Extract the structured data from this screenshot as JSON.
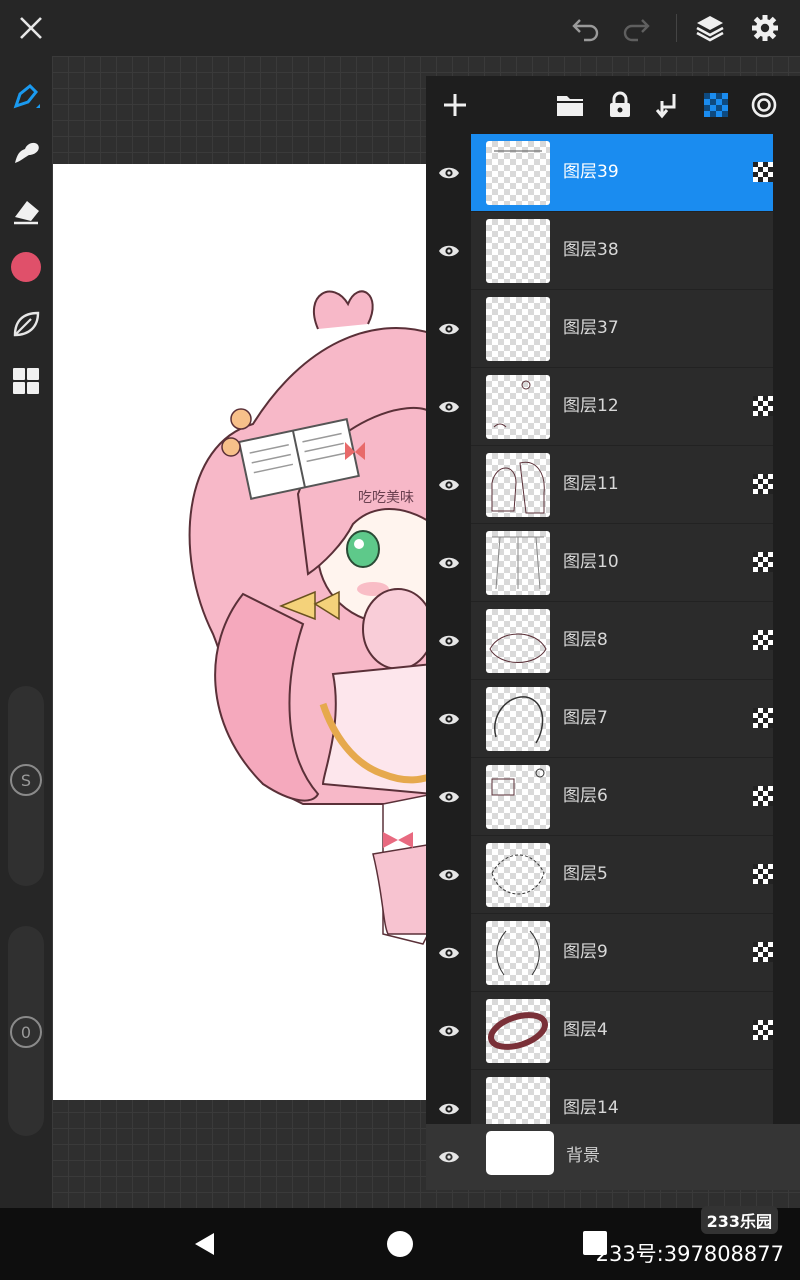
{
  "topbar": {
    "icons": [
      "close-icon",
      "undo-icon",
      "redo-icon",
      "layers-icon",
      "settings-icon"
    ]
  },
  "tools": {
    "icons": [
      "pen-icon",
      "smudge-icon",
      "eraser-icon",
      "color-swatch",
      "leaf-icon",
      "grid-icon"
    ],
    "color": "#e0506a",
    "size_slider_label": "S",
    "opacity_slider_label": "0"
  },
  "panel": {
    "toolbar_icons": [
      "add-icon",
      "folder-icon",
      "lock-icon",
      "merge-down-icon",
      "clipping-icon",
      "reference-icon"
    ],
    "layers": [
      {
        "name": "图层39",
        "selected": true,
        "clipping": true
      },
      {
        "name": "图层38",
        "selected": false,
        "clipping": false
      },
      {
        "name": "图层37",
        "selected": false,
        "clipping": false
      },
      {
        "name": "图层12",
        "selected": false,
        "clipping": true
      },
      {
        "name": "图层11",
        "selected": false,
        "clipping": true
      },
      {
        "name": "图层10",
        "selected": false,
        "clipping": true
      },
      {
        "name": "图层8",
        "selected": false,
        "clipping": true
      },
      {
        "name": "图层7",
        "selected": false,
        "clipping": true
      },
      {
        "name": "图层6",
        "selected": false,
        "clipping": true
      },
      {
        "name": "图层5",
        "selected": false,
        "clipping": true
      },
      {
        "name": "图层9",
        "selected": false,
        "clipping": true
      },
      {
        "name": "图层4",
        "selected": false,
        "clipping": true
      },
      {
        "name": "图层14",
        "selected": false,
        "clipping": false
      }
    ],
    "background_layer": "背景"
  },
  "canvas": {
    "artwork_text": "吃吃美味"
  },
  "watermark": {
    "logo": "233乐园",
    "id": "233号:397808877"
  },
  "colors": {
    "accent": "#1a8cf0",
    "pen_active": "#1a9af0"
  }
}
